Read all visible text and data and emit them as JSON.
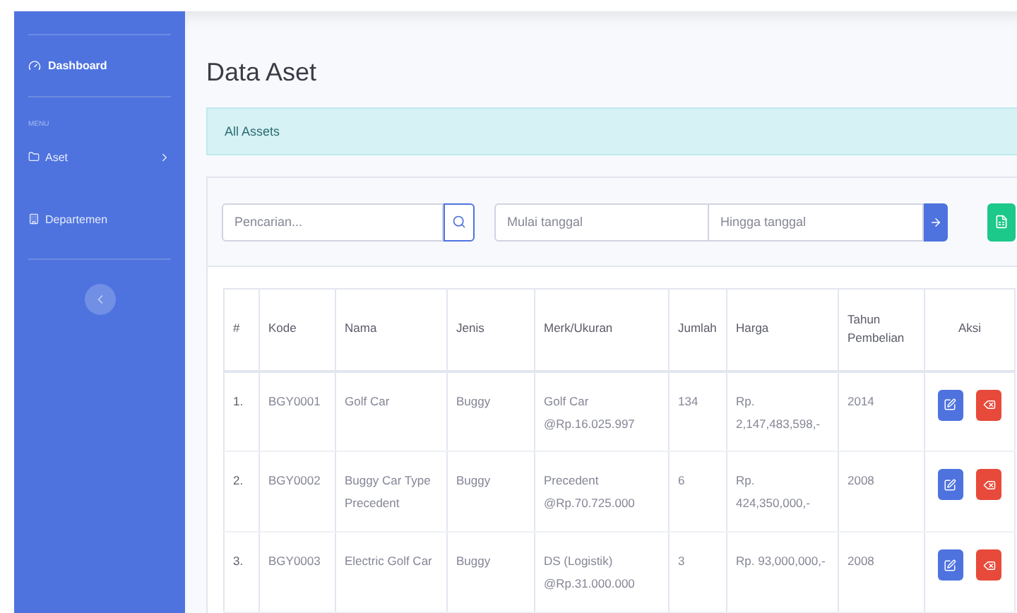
{
  "sidebar": {
    "brand": "Dashboard",
    "section": "MENU",
    "items": [
      {
        "label": "Aset",
        "kind": "folder",
        "has_children": true
      },
      {
        "label": "Departemen",
        "kind": "building",
        "has_children": false
      }
    ]
  },
  "page": {
    "title": "Data Aset",
    "breadcrumb": "All Assets"
  },
  "filters": {
    "search_placeholder": "Pencarian...",
    "start_placeholder": "Mulai tanggal",
    "end_placeholder": "Hingga tanggal"
  },
  "table": {
    "columns": [
      "#",
      "Kode",
      "Nama",
      "Jenis",
      "Merk/Ukuran",
      "Jumlah",
      "Harga",
      "Tahun Pembelian",
      "Aksi"
    ],
    "rows": [
      {
        "cells": [
          "1.",
          "BGY0001",
          "Golf Car",
          "Buggy",
          "Golf Car @Rp.16.025.997",
          "134",
          "Rp. 2,147,483,598,-",
          "2014"
        ]
      },
      {
        "cells": [
          "2.",
          "BGY0002",
          "Buggy Car Type Precedent",
          "Buggy",
          "Precedent @Rp.70.725.000",
          "6",
          "Rp. 424,350,000,-",
          "2008"
        ]
      },
      {
        "cells": [
          "3.",
          "BGY0003",
          "Electric Golf Car",
          "Buggy",
          "DS (Logistik) @Rp.31.000.000",
          "3",
          "Rp. 93,000,000,-",
          "2008"
        ]
      }
    ],
    "actions": [
      {
        "kind": "edit"
      },
      {
        "kind": "delete"
      }
    ]
  }
}
